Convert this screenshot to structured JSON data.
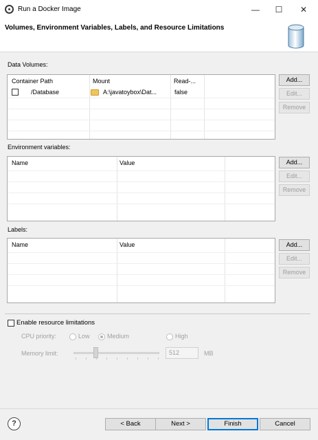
{
  "window": {
    "title": "Run a Docker Image",
    "minimize_glyph": "—",
    "maximize_glyph": "☐",
    "close_glyph": "✕"
  },
  "header": {
    "title": "Volumes, Environment Variables, Labels, and Resource Limitations",
    "image_icon": "database-icon"
  },
  "data_volumes": {
    "label": "Data Volumes:",
    "columns": [
      "Container Path",
      "Mount",
      "Read-..."
    ],
    "rows": [
      {
        "checked": false,
        "container_path": "/Database",
        "mount": "A:\\javatoybox\\Dat...",
        "read_only": "false"
      }
    ],
    "buttons": {
      "add": "Add...",
      "edit": "Edit...",
      "remove": "Remove"
    }
  },
  "env_vars": {
    "label": "Environment variables:",
    "columns": [
      "Name",
      "Value"
    ],
    "rows": [],
    "buttons": {
      "add": "Add...",
      "edit": "Edit...",
      "remove": "Remove"
    }
  },
  "labels": {
    "label": "Labels:",
    "columns": [
      "Name",
      "Value"
    ],
    "rows": [],
    "buttons": {
      "add": "Add...",
      "edit": "Edit...",
      "remove": "Remove"
    }
  },
  "resources": {
    "enable_label": "Enable resource limitations",
    "enabled": false,
    "cpu_priority_label": "CPU priority:",
    "cpu_options": [
      "Low",
      "Medium",
      "High"
    ],
    "cpu_selected": "Medium",
    "memory_limit_label": "Memory limit:",
    "memory_value": "512",
    "memory_unit": "MB"
  },
  "footer": {
    "help": "?",
    "back": "< Back",
    "next": "Next >",
    "finish": "Finish",
    "cancel": "Cancel"
  },
  "colors": {
    "accent": "#0078d7",
    "disabled_text": "#9c9c9c"
  }
}
